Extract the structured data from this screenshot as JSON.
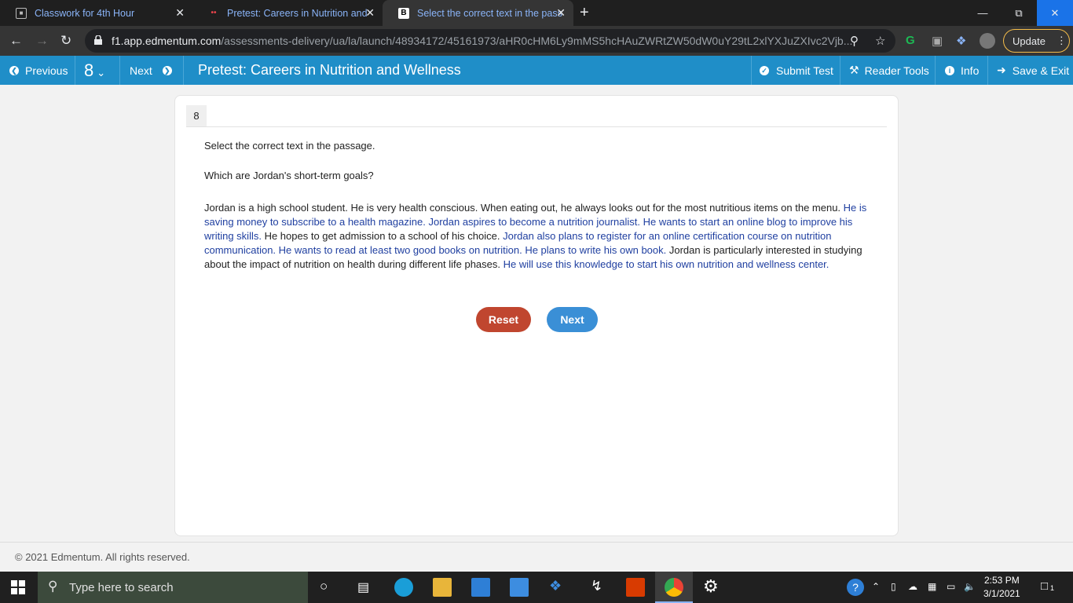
{
  "browser": {
    "tabs": [
      {
        "label": "Classwork for 4th Hour",
        "active": false
      },
      {
        "label": "Pretest: Careers in Nutrition and",
        "active": false
      },
      {
        "label": "Select the correct text in the pass",
        "active": true
      }
    ],
    "url_host": "f1.app.edmentum.com",
    "url_path": "/assessments-delivery/ua/la/launch/48934172/45161973/aHR0cHM6Ly9mMS5hcHAuZWRtZW50dW0uY29tL2xlYXJuZXIvc2Vjb...",
    "update_label": "Update"
  },
  "header": {
    "previous_label": "Previous",
    "question_number": "8",
    "next_label": "Next",
    "title": "Pretest: Careers in Nutrition and Wellness",
    "submit_label": "Submit Test",
    "reader_tools_label": "Reader Tools",
    "info_label": "Info",
    "save_exit_label": "Save & Exit"
  },
  "question": {
    "number": "8",
    "instruction": "Select the correct text in the passage.",
    "prompt": "Which are Jordan's short-term goals?",
    "passage": [
      {
        "text": "Jordan is a high school student. He is very health conscious. When eating out, he always looks out for the most nutritious items on the menu. ",
        "selectable": false
      },
      {
        "text": "He is saving money to subscribe to a health magazine.",
        "selectable": true
      },
      {
        "text": " ",
        "selectable": false
      },
      {
        "text": "Jordan aspires to become a nutrition journalist.",
        "selectable": true
      },
      {
        "text": " ",
        "selectable": false
      },
      {
        "text": "He wants to start an online blog to improve his writing skills.",
        "selectable": true
      },
      {
        "text": " He hopes to get admission to a school of his choice. ",
        "selectable": false
      },
      {
        "text": "Jordan also plans to register for an online certification course on nutrition communication.",
        "selectable": true
      },
      {
        "text": " ",
        "selectable": false
      },
      {
        "text": "He wants to read at least two good books on nutrition.",
        "selectable": true
      },
      {
        "text": " ",
        "selectable": false
      },
      {
        "text": "He plans to write his own book.",
        "selectable": true
      },
      {
        "text": " Jordan is particularly interested in studying about the impact of nutrition on health during different life phases. ",
        "selectable": false
      },
      {
        "text": "He will use this knowledge to start his own nutrition and wellness center.",
        "selectable": true
      }
    ],
    "reset_label": "Reset",
    "next_label": "Next"
  },
  "footer": {
    "copyright": "© 2021 Edmentum. All rights reserved."
  },
  "taskbar": {
    "search_placeholder": "Type here to search",
    "time": "2:53 PM",
    "date": "3/1/2021",
    "notification_count": "1"
  },
  "colors": {
    "header": "#1f8ec8",
    "reset": "#c0462f",
    "next": "#3a8fd6",
    "selectable_text": "#1f3fa0"
  }
}
